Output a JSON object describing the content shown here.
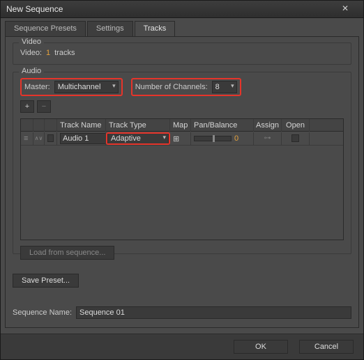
{
  "window": {
    "title": "New Sequence"
  },
  "tabs": {
    "presets": "Sequence Presets",
    "settings": "Settings",
    "tracks": "Tracks",
    "active": "tracks"
  },
  "video": {
    "group_label": "Video",
    "video_label": "Video:",
    "tracks_count": "1",
    "tracks_suffix": "tracks"
  },
  "audio": {
    "group_label": "Audio",
    "master_label": "Master:",
    "master_value": "Multichannel",
    "channels_label": "Number of Channels:",
    "channels_value": "8",
    "add_btn": "+",
    "remove_btn": "−",
    "headers": {
      "name": "Track Name",
      "type": "Track Type",
      "map": "Map",
      "pan": "Pan/Balance",
      "assign": "Assign",
      "open": "Open"
    },
    "tracks": [
      {
        "name": "Audio 1",
        "type": "Adaptive",
        "pan": "0"
      }
    ],
    "load_btn": "Load from sequence..."
  },
  "save_preset_btn": "Save Preset...",
  "sequence": {
    "label": "Sequence Name:",
    "value": "Sequence 01"
  },
  "footer": {
    "ok": "OK",
    "cancel": "Cancel"
  }
}
